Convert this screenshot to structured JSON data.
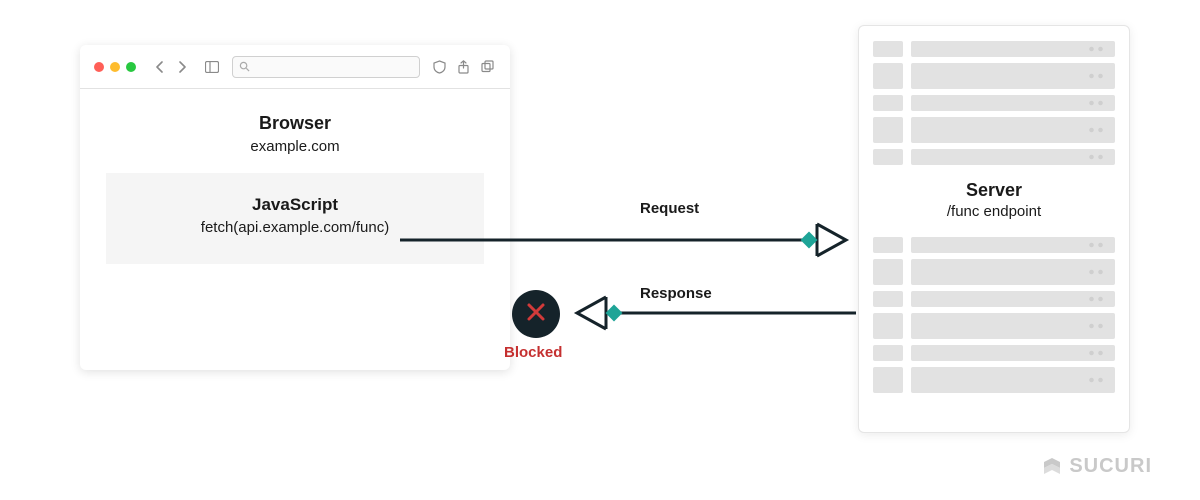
{
  "browser": {
    "title": "Browser",
    "domain": "example.com",
    "js_title": "JavaScript",
    "js_call": "fetch(api.example.com/func)"
  },
  "arrows": {
    "request_label": "Request",
    "response_label": "Response",
    "blocked_label": "Blocked"
  },
  "server": {
    "title": "Server",
    "subtitle": "/func endpoint"
  },
  "logo": {
    "text": "SUCURI"
  },
  "colors": {
    "teal": "#1ea497",
    "dark": "#15232a",
    "red": "#c53030"
  }
}
